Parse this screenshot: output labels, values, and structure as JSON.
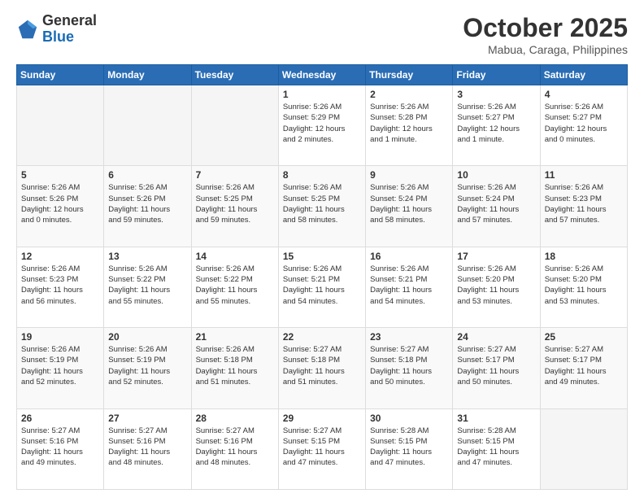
{
  "header": {
    "logo": {
      "general": "General",
      "blue": "Blue"
    },
    "title": "October 2025",
    "location": "Mabua, Caraga, Philippines"
  },
  "weekdays": [
    "Sunday",
    "Monday",
    "Tuesday",
    "Wednesday",
    "Thursday",
    "Friday",
    "Saturday"
  ],
  "weeks": [
    [
      {
        "day": "",
        "info": ""
      },
      {
        "day": "",
        "info": ""
      },
      {
        "day": "",
        "info": ""
      },
      {
        "day": "1",
        "info": "Sunrise: 5:26 AM\nSunset: 5:29 PM\nDaylight: 12 hours\nand 2 minutes."
      },
      {
        "day": "2",
        "info": "Sunrise: 5:26 AM\nSunset: 5:28 PM\nDaylight: 12 hours\nand 1 minute."
      },
      {
        "day": "3",
        "info": "Sunrise: 5:26 AM\nSunset: 5:27 PM\nDaylight: 12 hours\nand 1 minute."
      },
      {
        "day": "4",
        "info": "Sunrise: 5:26 AM\nSunset: 5:27 PM\nDaylight: 12 hours\nand 0 minutes."
      }
    ],
    [
      {
        "day": "5",
        "info": "Sunrise: 5:26 AM\nSunset: 5:26 PM\nDaylight: 12 hours\nand 0 minutes."
      },
      {
        "day": "6",
        "info": "Sunrise: 5:26 AM\nSunset: 5:26 PM\nDaylight: 11 hours\nand 59 minutes."
      },
      {
        "day": "7",
        "info": "Sunrise: 5:26 AM\nSunset: 5:25 PM\nDaylight: 11 hours\nand 59 minutes."
      },
      {
        "day": "8",
        "info": "Sunrise: 5:26 AM\nSunset: 5:25 PM\nDaylight: 11 hours\nand 58 minutes."
      },
      {
        "day": "9",
        "info": "Sunrise: 5:26 AM\nSunset: 5:24 PM\nDaylight: 11 hours\nand 58 minutes."
      },
      {
        "day": "10",
        "info": "Sunrise: 5:26 AM\nSunset: 5:24 PM\nDaylight: 11 hours\nand 57 minutes."
      },
      {
        "day": "11",
        "info": "Sunrise: 5:26 AM\nSunset: 5:23 PM\nDaylight: 11 hours\nand 57 minutes."
      }
    ],
    [
      {
        "day": "12",
        "info": "Sunrise: 5:26 AM\nSunset: 5:23 PM\nDaylight: 11 hours\nand 56 minutes."
      },
      {
        "day": "13",
        "info": "Sunrise: 5:26 AM\nSunset: 5:22 PM\nDaylight: 11 hours\nand 55 minutes."
      },
      {
        "day": "14",
        "info": "Sunrise: 5:26 AM\nSunset: 5:22 PM\nDaylight: 11 hours\nand 55 minutes."
      },
      {
        "day": "15",
        "info": "Sunrise: 5:26 AM\nSunset: 5:21 PM\nDaylight: 11 hours\nand 54 minutes."
      },
      {
        "day": "16",
        "info": "Sunrise: 5:26 AM\nSunset: 5:21 PM\nDaylight: 11 hours\nand 54 minutes."
      },
      {
        "day": "17",
        "info": "Sunrise: 5:26 AM\nSunset: 5:20 PM\nDaylight: 11 hours\nand 53 minutes."
      },
      {
        "day": "18",
        "info": "Sunrise: 5:26 AM\nSunset: 5:20 PM\nDaylight: 11 hours\nand 53 minutes."
      }
    ],
    [
      {
        "day": "19",
        "info": "Sunrise: 5:26 AM\nSunset: 5:19 PM\nDaylight: 11 hours\nand 52 minutes."
      },
      {
        "day": "20",
        "info": "Sunrise: 5:26 AM\nSunset: 5:19 PM\nDaylight: 11 hours\nand 52 minutes."
      },
      {
        "day": "21",
        "info": "Sunrise: 5:26 AM\nSunset: 5:18 PM\nDaylight: 11 hours\nand 51 minutes."
      },
      {
        "day": "22",
        "info": "Sunrise: 5:27 AM\nSunset: 5:18 PM\nDaylight: 11 hours\nand 51 minutes."
      },
      {
        "day": "23",
        "info": "Sunrise: 5:27 AM\nSunset: 5:18 PM\nDaylight: 11 hours\nand 50 minutes."
      },
      {
        "day": "24",
        "info": "Sunrise: 5:27 AM\nSunset: 5:17 PM\nDaylight: 11 hours\nand 50 minutes."
      },
      {
        "day": "25",
        "info": "Sunrise: 5:27 AM\nSunset: 5:17 PM\nDaylight: 11 hours\nand 49 minutes."
      }
    ],
    [
      {
        "day": "26",
        "info": "Sunrise: 5:27 AM\nSunset: 5:16 PM\nDaylight: 11 hours\nand 49 minutes."
      },
      {
        "day": "27",
        "info": "Sunrise: 5:27 AM\nSunset: 5:16 PM\nDaylight: 11 hours\nand 48 minutes."
      },
      {
        "day": "28",
        "info": "Sunrise: 5:27 AM\nSunset: 5:16 PM\nDaylight: 11 hours\nand 48 minutes."
      },
      {
        "day": "29",
        "info": "Sunrise: 5:27 AM\nSunset: 5:15 PM\nDaylight: 11 hours\nand 47 minutes."
      },
      {
        "day": "30",
        "info": "Sunrise: 5:28 AM\nSunset: 5:15 PM\nDaylight: 11 hours\nand 47 minutes."
      },
      {
        "day": "31",
        "info": "Sunrise: 5:28 AM\nSunset: 5:15 PM\nDaylight: 11 hours\nand 47 minutes."
      },
      {
        "day": "",
        "info": ""
      }
    ]
  ]
}
